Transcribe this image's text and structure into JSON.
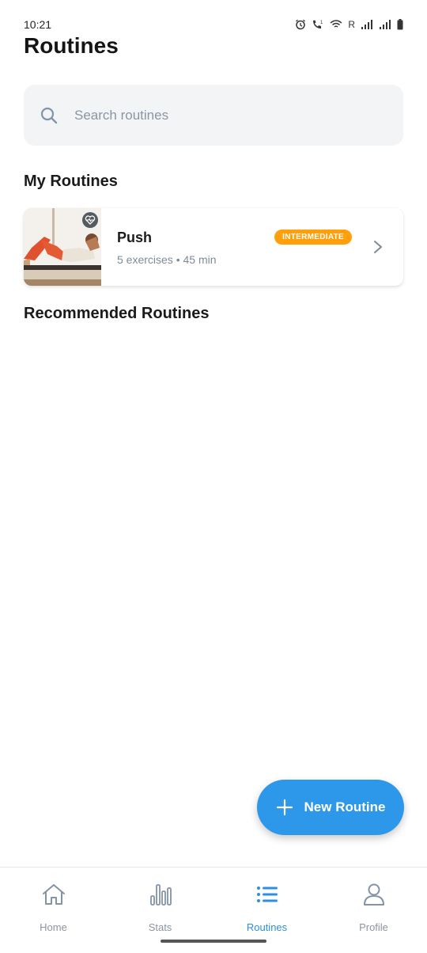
{
  "status_bar": {
    "time": "10:21",
    "network_letter": "R",
    "icons": [
      "alarm-icon",
      "wifi-call-icon",
      "wifi-icon",
      "signal-icon",
      "signal-icon",
      "battery-icon"
    ]
  },
  "page": {
    "title": "Routines"
  },
  "search": {
    "placeholder": "Search routines",
    "value": ""
  },
  "sections": {
    "my_routines": "My Routines",
    "recommended": "Recommended Routines"
  },
  "my_routines": [
    {
      "name": "Push",
      "meta": "5 exercises • 45 min",
      "level": "INTERMEDIATE",
      "level_color": "#ff9f0a",
      "thumb_icon": "heart-pulse-icon"
    }
  ],
  "fab": {
    "label": "New Routine",
    "icon": "plus-icon",
    "color": "#2d97e9"
  },
  "bottom_nav": {
    "items": [
      {
        "label": "Home",
        "icon": "home-icon",
        "active": false
      },
      {
        "label": "Stats",
        "icon": "stats-icon",
        "active": false
      },
      {
        "label": "Routines",
        "icon": "list-icon",
        "active": true
      },
      {
        "label": "Profile",
        "icon": "profile-icon",
        "active": false
      }
    ],
    "active_color": "#2d8fe0",
    "inactive_color": "#8a96a3"
  }
}
